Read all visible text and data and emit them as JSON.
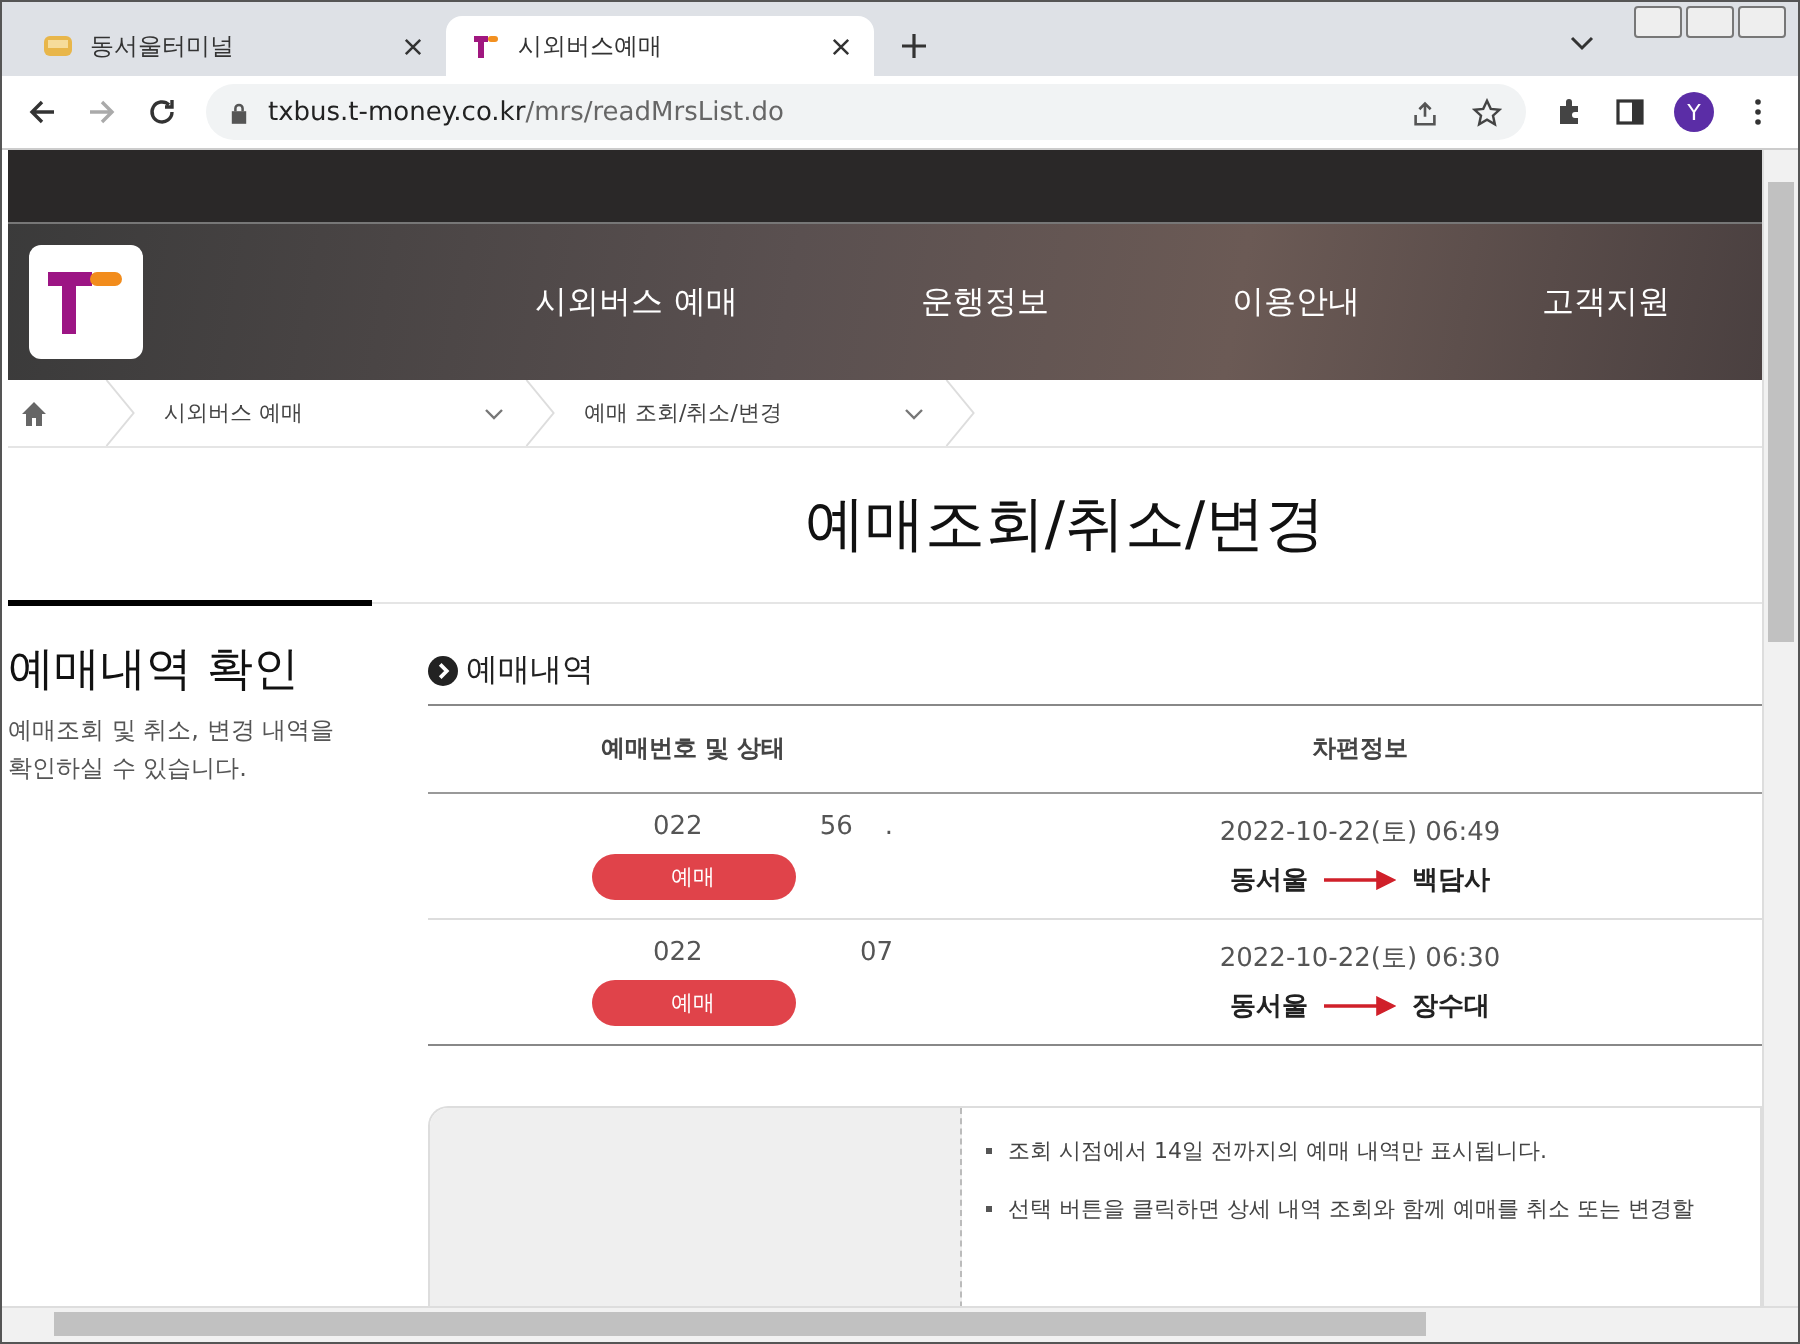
{
  "browser": {
    "tabs": [
      {
        "title": "동서울터미널",
        "selected": false,
        "kind": "terminal"
      },
      {
        "title": "시외버스예매",
        "selected": true,
        "kind": "tmoney"
      }
    ],
    "url": {
      "host": "txbus.t-money.co.kr",
      "path": "/mrs/readMrsList.do"
    },
    "profile": "Y"
  },
  "nav": [
    "시외버스 예매",
    "운행정보",
    "이용안내",
    "고객지원"
  ],
  "breadcrumb": [
    "시외버스 예매",
    "예매 조회/취소/변경"
  ],
  "page_title": "예매조회/취소/변경",
  "sidebar": {
    "title": "예매내역 확인",
    "description": "예매조회 및 취소, 변경 내역을\n확인하실 수 있습니다."
  },
  "section_title": "예매내역",
  "table": {
    "columns": [
      "예매번호 및 상태",
      "차편정보"
    ],
    "rows": [
      {
        "number_parts": [
          "022",
          "56",
          "."
        ],
        "status": "예매",
        "datetime": "2022-10-22(토) 06:49",
        "from": "동서울",
        "to": "백담사"
      },
      {
        "number_parts": [
          "022",
          "07"
        ],
        "status": "예매",
        "datetime": "2022-10-22(토) 06:30",
        "from": "동서울",
        "to": "장수대"
      }
    ]
  },
  "notices": [
    "조회 시점에서 14일 전까지의 예매 내역만 표시됩니다.",
    "선택 버튼을 클릭하면 상세 내역 조회와 함께 예매를 취소 또는 변경할"
  ]
}
